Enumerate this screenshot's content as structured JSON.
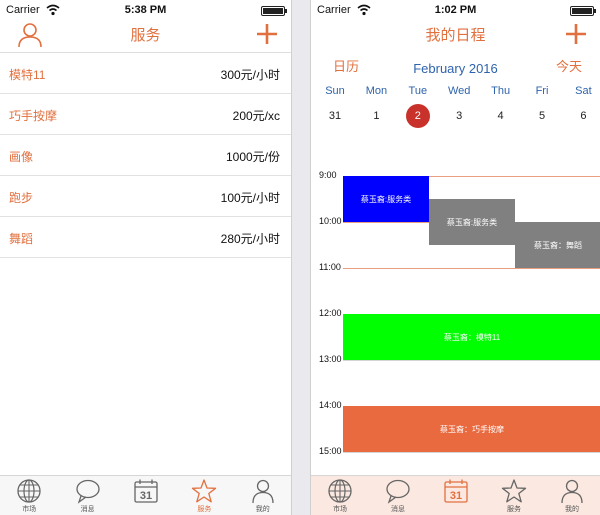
{
  "left_phone": {
    "status": {
      "carrier": "Carrier",
      "time": "5:38 PM"
    },
    "nav": {
      "title": "服务"
    },
    "services": [
      {
        "name": "模特11",
        "price": "300元/小时"
      },
      {
        "name": "巧手按摩",
        "price": "200元/xc"
      },
      {
        "name": "画像",
        "price": "1000元/份"
      },
      {
        "name": "跑步",
        "price": "100元/小时"
      },
      {
        "name": "舞蹈",
        "price": "280元/小时"
      }
    ],
    "tabs": [
      {
        "label": "市场",
        "icon": "globe-icon"
      },
      {
        "label": "消息",
        "icon": "chat-bubble-icon"
      },
      {
        "label": "",
        "icon": "calendar-icon",
        "day": "31"
      },
      {
        "label": "服务",
        "icon": "star-icon"
      },
      {
        "label": "我的",
        "icon": "person-icon"
      }
    ]
  },
  "right_phone": {
    "status": {
      "carrier": "Carrier",
      "time": "1:02 PM"
    },
    "nav": {
      "title": "我的日程"
    },
    "calendar": {
      "left_link": "日历",
      "right_link": "今天",
      "month": "February 2016",
      "weekdays": [
        "Sun",
        "Mon",
        "Tue",
        "Wed",
        "Thu",
        "Fri",
        "Sat"
      ],
      "dates": [
        "31",
        "1",
        "2",
        "3",
        "4",
        "5",
        "6"
      ],
      "selected_index": 2
    },
    "hours": [
      "9:00",
      "10:00",
      "11:00",
      "12:00",
      "13:00",
      "14:00",
      "15:00"
    ],
    "events": [
      {
        "text": "蔡玉裔:服务类",
        "start": 9.0,
        "end": 10.0,
        "column": 0,
        "color": "#0000ff"
      },
      {
        "text": "蔡玉裔:服务类",
        "start": 9.5,
        "end": 10.5,
        "column": 1,
        "color": "#808080"
      },
      {
        "text": "蔡玉裔：舞蹈",
        "start": 10.0,
        "end": 11.0,
        "column": 2,
        "color": "#808080"
      },
      {
        "text": "蔡玉裔：模特11",
        "start": 12.0,
        "end": 13.0,
        "column": -1,
        "color": "#00ff00"
      },
      {
        "text": "蔡玉裔：巧手按摩",
        "start": 14.0,
        "end": 15.0,
        "column": -1,
        "color": "#ea6a3f"
      }
    ],
    "tabs": [
      {
        "label": "市场",
        "icon": "globe-icon"
      },
      {
        "label": "消息",
        "icon": "chat-bubble-icon"
      },
      {
        "label": "",
        "icon": "calendar-icon",
        "day": "31"
      },
      {
        "label": "服务",
        "icon": "star-icon"
      },
      {
        "label": "我的",
        "icon": "person-icon"
      }
    ]
  },
  "colors": {
    "accent": "#e2703f",
    "month_blue": "#2e63ad",
    "selected_red": "#c9322b",
    "hour_line_orange": "#e8a080",
    "hour_line_gray": "#d4d4d4"
  }
}
